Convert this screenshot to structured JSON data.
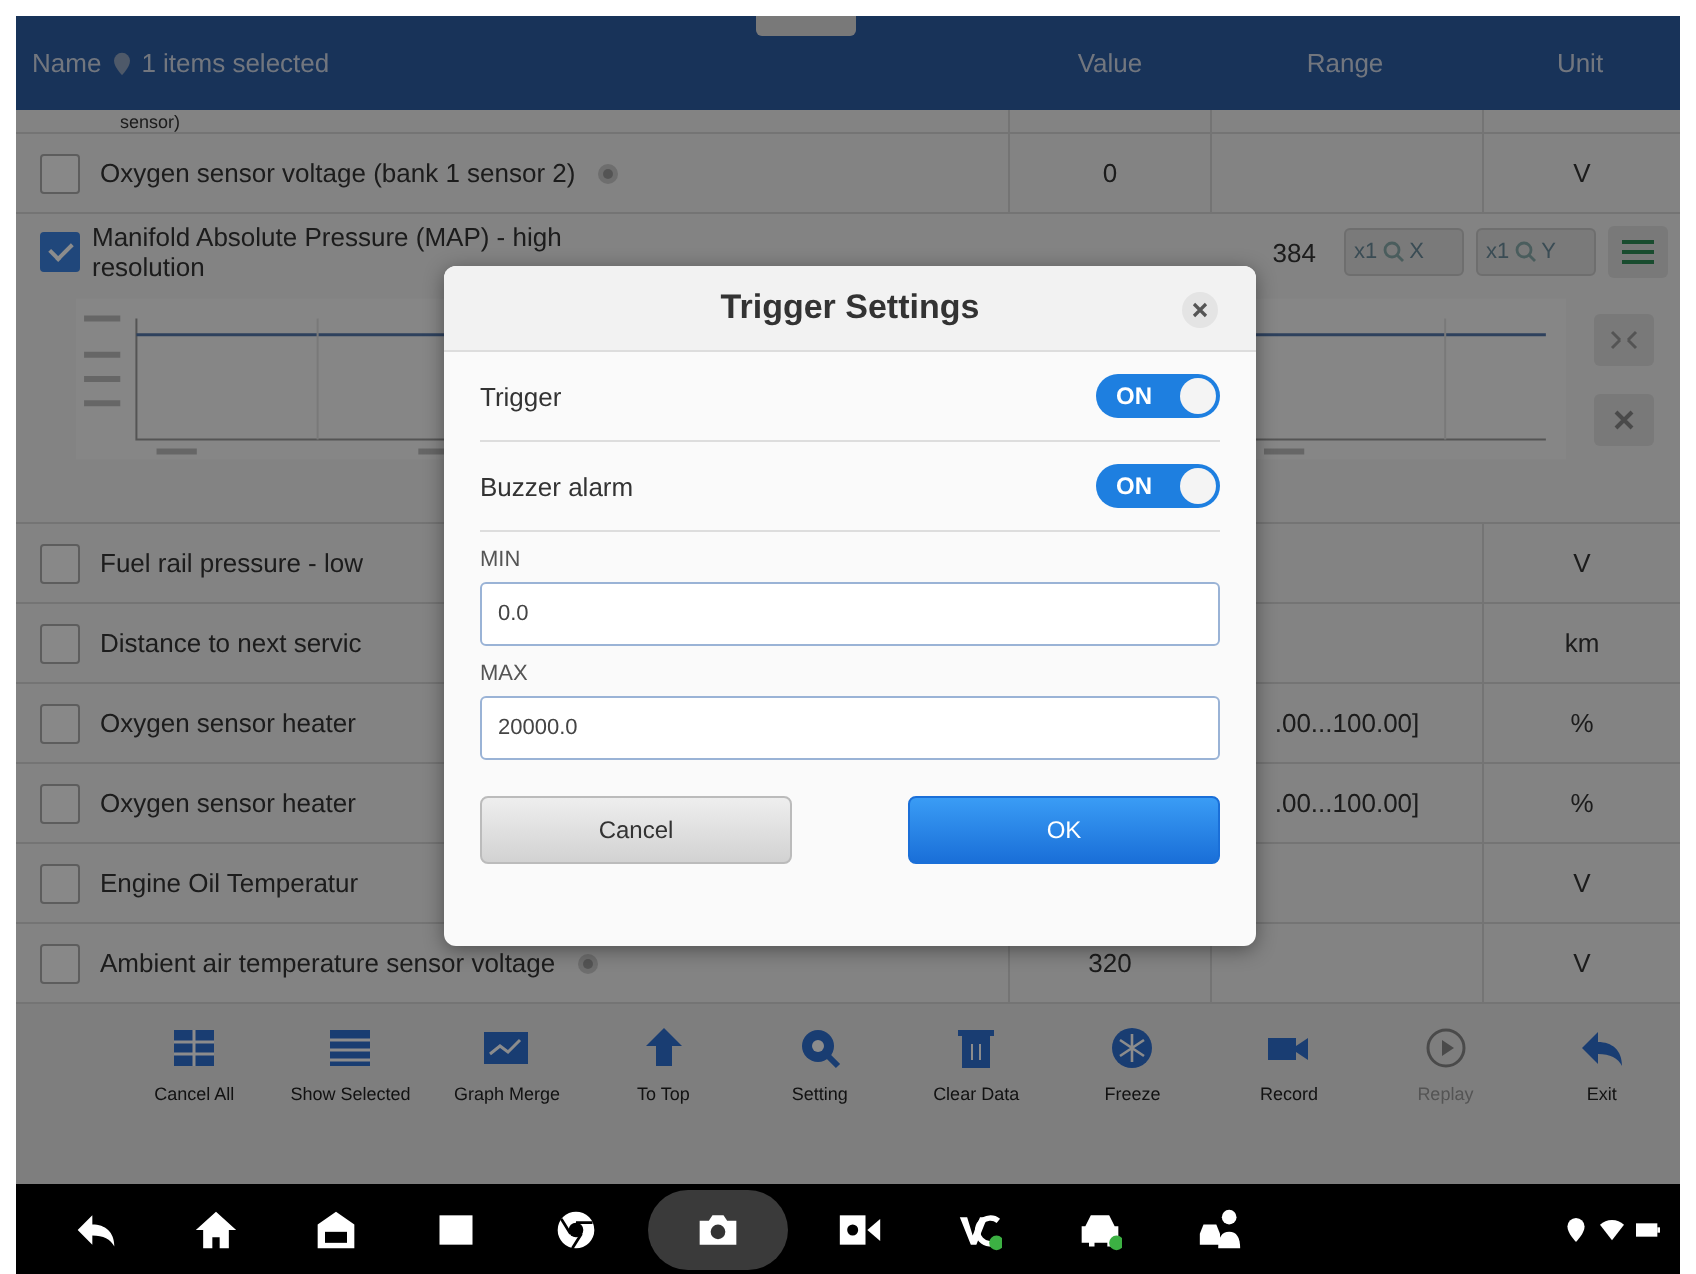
{
  "header": {
    "name_label": "Name",
    "selection": "1 items selected",
    "columns": [
      "Value",
      "Range",
      "Unit"
    ]
  },
  "partial_row": {
    "name": "sensor)"
  },
  "rows": [
    {
      "kind": "plain",
      "checked": false,
      "name": "Oxygen sensor voltage (bank 1 sensor 2)",
      "info": true,
      "value": "0",
      "range": "",
      "unit": "V"
    },
    {
      "kind": "graph",
      "checked": true,
      "name": "Manifold Absolute Pressure (MAP) - high resolution",
      "info": false,
      "value": "384",
      "zoom_buttons": [
        {
          "scale": "x1",
          "axis": "X"
        },
        {
          "scale": "x1",
          "axis": "Y"
        }
      ]
    },
    {
      "kind": "plain",
      "checked": false,
      "name": "Fuel rail pressure - low",
      "info": false,
      "value": "",
      "range": "",
      "unit": "V"
    },
    {
      "kind": "plain",
      "checked": false,
      "name": "Distance to next servic",
      "info": false,
      "value": "",
      "range": "",
      "unit": "km"
    },
    {
      "kind": "plain",
      "checked": false,
      "name": "Oxygen sensor heater",
      "info": false,
      "value": "",
      "range": ".00...100.00]",
      "unit": "%"
    },
    {
      "kind": "plain",
      "checked": false,
      "name": "Oxygen sensor heater",
      "info": false,
      "value": "",
      "range": ".00...100.00]",
      "unit": "%"
    },
    {
      "kind": "plain",
      "checked": false,
      "name": "Engine Oil Temperatur",
      "info": false,
      "value": "",
      "range": "",
      "unit": "V"
    },
    {
      "kind": "plain",
      "checked": false,
      "name": "Ambient air temperature sensor voltage",
      "info": true,
      "value": "320",
      "range": "",
      "unit": "V"
    }
  ],
  "toolbar": [
    {
      "kind": "cancel-all",
      "label": "Cancel All",
      "disabled": false
    },
    {
      "kind": "show-selected",
      "label": "Show Selected",
      "disabled": false
    },
    {
      "kind": "graph-merge",
      "label": "Graph Merge",
      "disabled": false
    },
    {
      "kind": "to-top",
      "label": "To Top",
      "disabled": false
    },
    {
      "kind": "setting",
      "label": "Setting",
      "disabled": false
    },
    {
      "kind": "clear-data",
      "label": "Clear Data",
      "disabled": false
    },
    {
      "kind": "freeze",
      "label": "Freeze",
      "disabled": false
    },
    {
      "kind": "record",
      "label": "Record",
      "disabled": false
    },
    {
      "kind": "replay",
      "label": "Replay",
      "disabled": true
    },
    {
      "kind": "exit",
      "label": "Exit",
      "disabled": false
    }
  ],
  "nav_bar": [
    {
      "kind": "back",
      "selected": false
    },
    {
      "kind": "home",
      "selected": false
    },
    {
      "kind": "garage",
      "selected": false
    },
    {
      "kind": "square",
      "selected": false
    },
    {
      "kind": "browser",
      "selected": false
    },
    {
      "kind": "camera",
      "selected": true
    },
    {
      "kind": "video",
      "selected": false
    },
    {
      "kind": "vci",
      "selected": false
    },
    {
      "kind": "car",
      "selected": false
    },
    {
      "kind": "person-car",
      "selected": false
    }
  ],
  "dialog": {
    "title": "Trigger Settings",
    "toggles": [
      {
        "label": "Trigger",
        "on": true,
        "state_text": "ON"
      },
      {
        "label": "Buzzer alarm",
        "on": true,
        "state_text": "ON"
      }
    ],
    "fields": [
      {
        "label": "MIN",
        "value": "0.0"
      },
      {
        "label": "MAX",
        "value": "20000.0"
      }
    ],
    "buttons": [
      {
        "kind": "secondary",
        "label": "Cancel"
      },
      {
        "kind": "primary",
        "label": "OK"
      }
    ]
  }
}
